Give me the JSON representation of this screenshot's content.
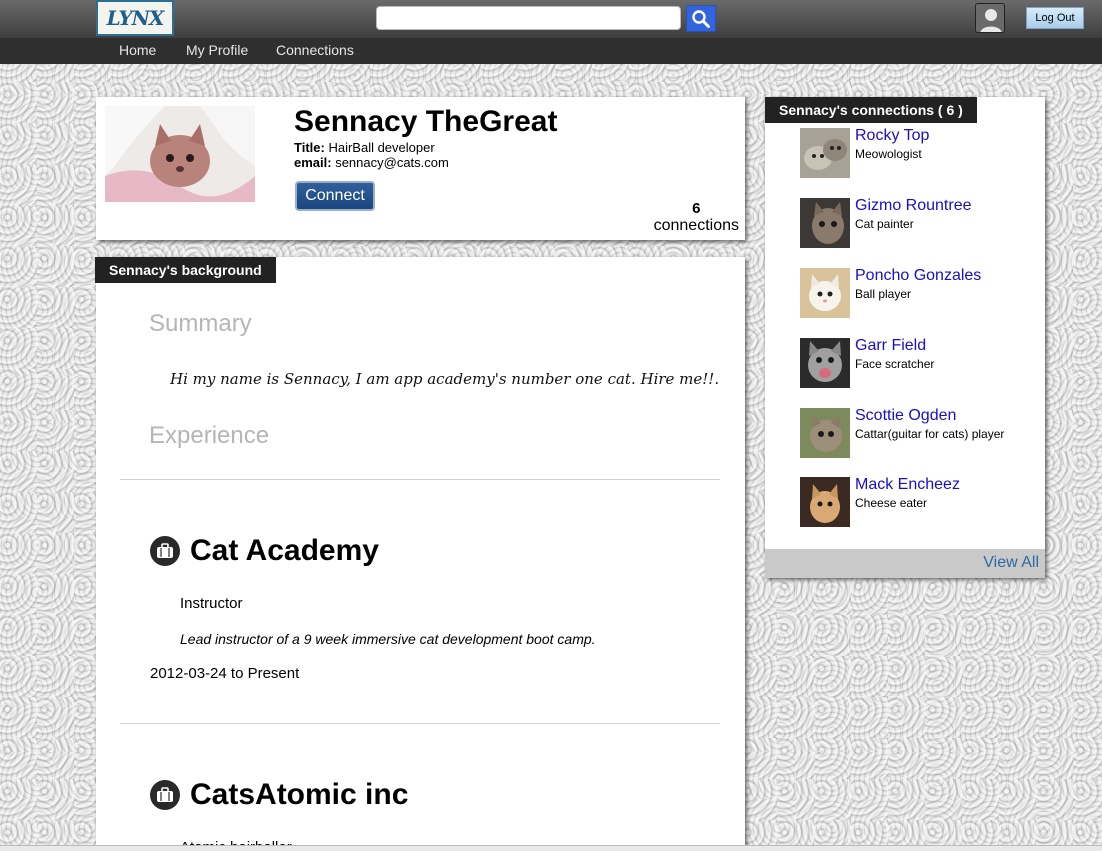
{
  "header": {
    "logo_text": "LYNX",
    "search": {
      "value": "",
      "placeholder": ""
    },
    "logout_label": "Log Out"
  },
  "nav": {
    "items": [
      {
        "label": "Home"
      },
      {
        "label": "My Profile"
      },
      {
        "label": "Connections"
      }
    ]
  },
  "profile": {
    "name": "Sennacy TheGreat",
    "title_label": "Title:",
    "title_value": "HairBall developer",
    "email_label": "email:",
    "email_value": "sennacy@cats.com",
    "connect_label": "Connect",
    "connection_count": "6",
    "connection_word": "connections"
  },
  "background": {
    "tab_label": "Sennacy's background",
    "summary_heading": "Summary",
    "summary_text": "Hi my name is Sennacy, I am app academy's number one cat. Hire me!!.",
    "experience_heading": "Experience",
    "experiences": [
      {
        "company": "Cat Academy",
        "title": "Instructor",
        "description": "Lead instructor of a 9 week immersive cat development boot camp.",
        "dates": "2012-03-24 to Present"
      },
      {
        "company": "CatsAtomic inc",
        "title": "Atomic hairballer"
      }
    ]
  },
  "connections": {
    "tab_label": "Sennacy's connections ( 6 )",
    "items": [
      {
        "name": "Rocky Top",
        "title": "Meowologist"
      },
      {
        "name": "Gizmo Rountree",
        "title": "Cat painter"
      },
      {
        "name": "Poncho Gonzales",
        "title": "Ball player"
      },
      {
        "name": "Garr Field",
        "title": "Face scratcher"
      },
      {
        "name": "Scottie Ogden",
        "title": "Cattar(guitar for cats) player"
      },
      {
        "name": "Mack Encheez",
        "title": "Cheese eater"
      }
    ],
    "view_all_label": "View All"
  },
  "icons": [
    "search-icon",
    "user-avatar-icon",
    "briefcase-icon"
  ],
  "colors": {
    "topbar": "#4a4a4a",
    "navbar": "#2f2f2f",
    "link_blue": "#1a0dcc",
    "connect_button": "#1c467e",
    "search_button": "#3364e0"
  }
}
